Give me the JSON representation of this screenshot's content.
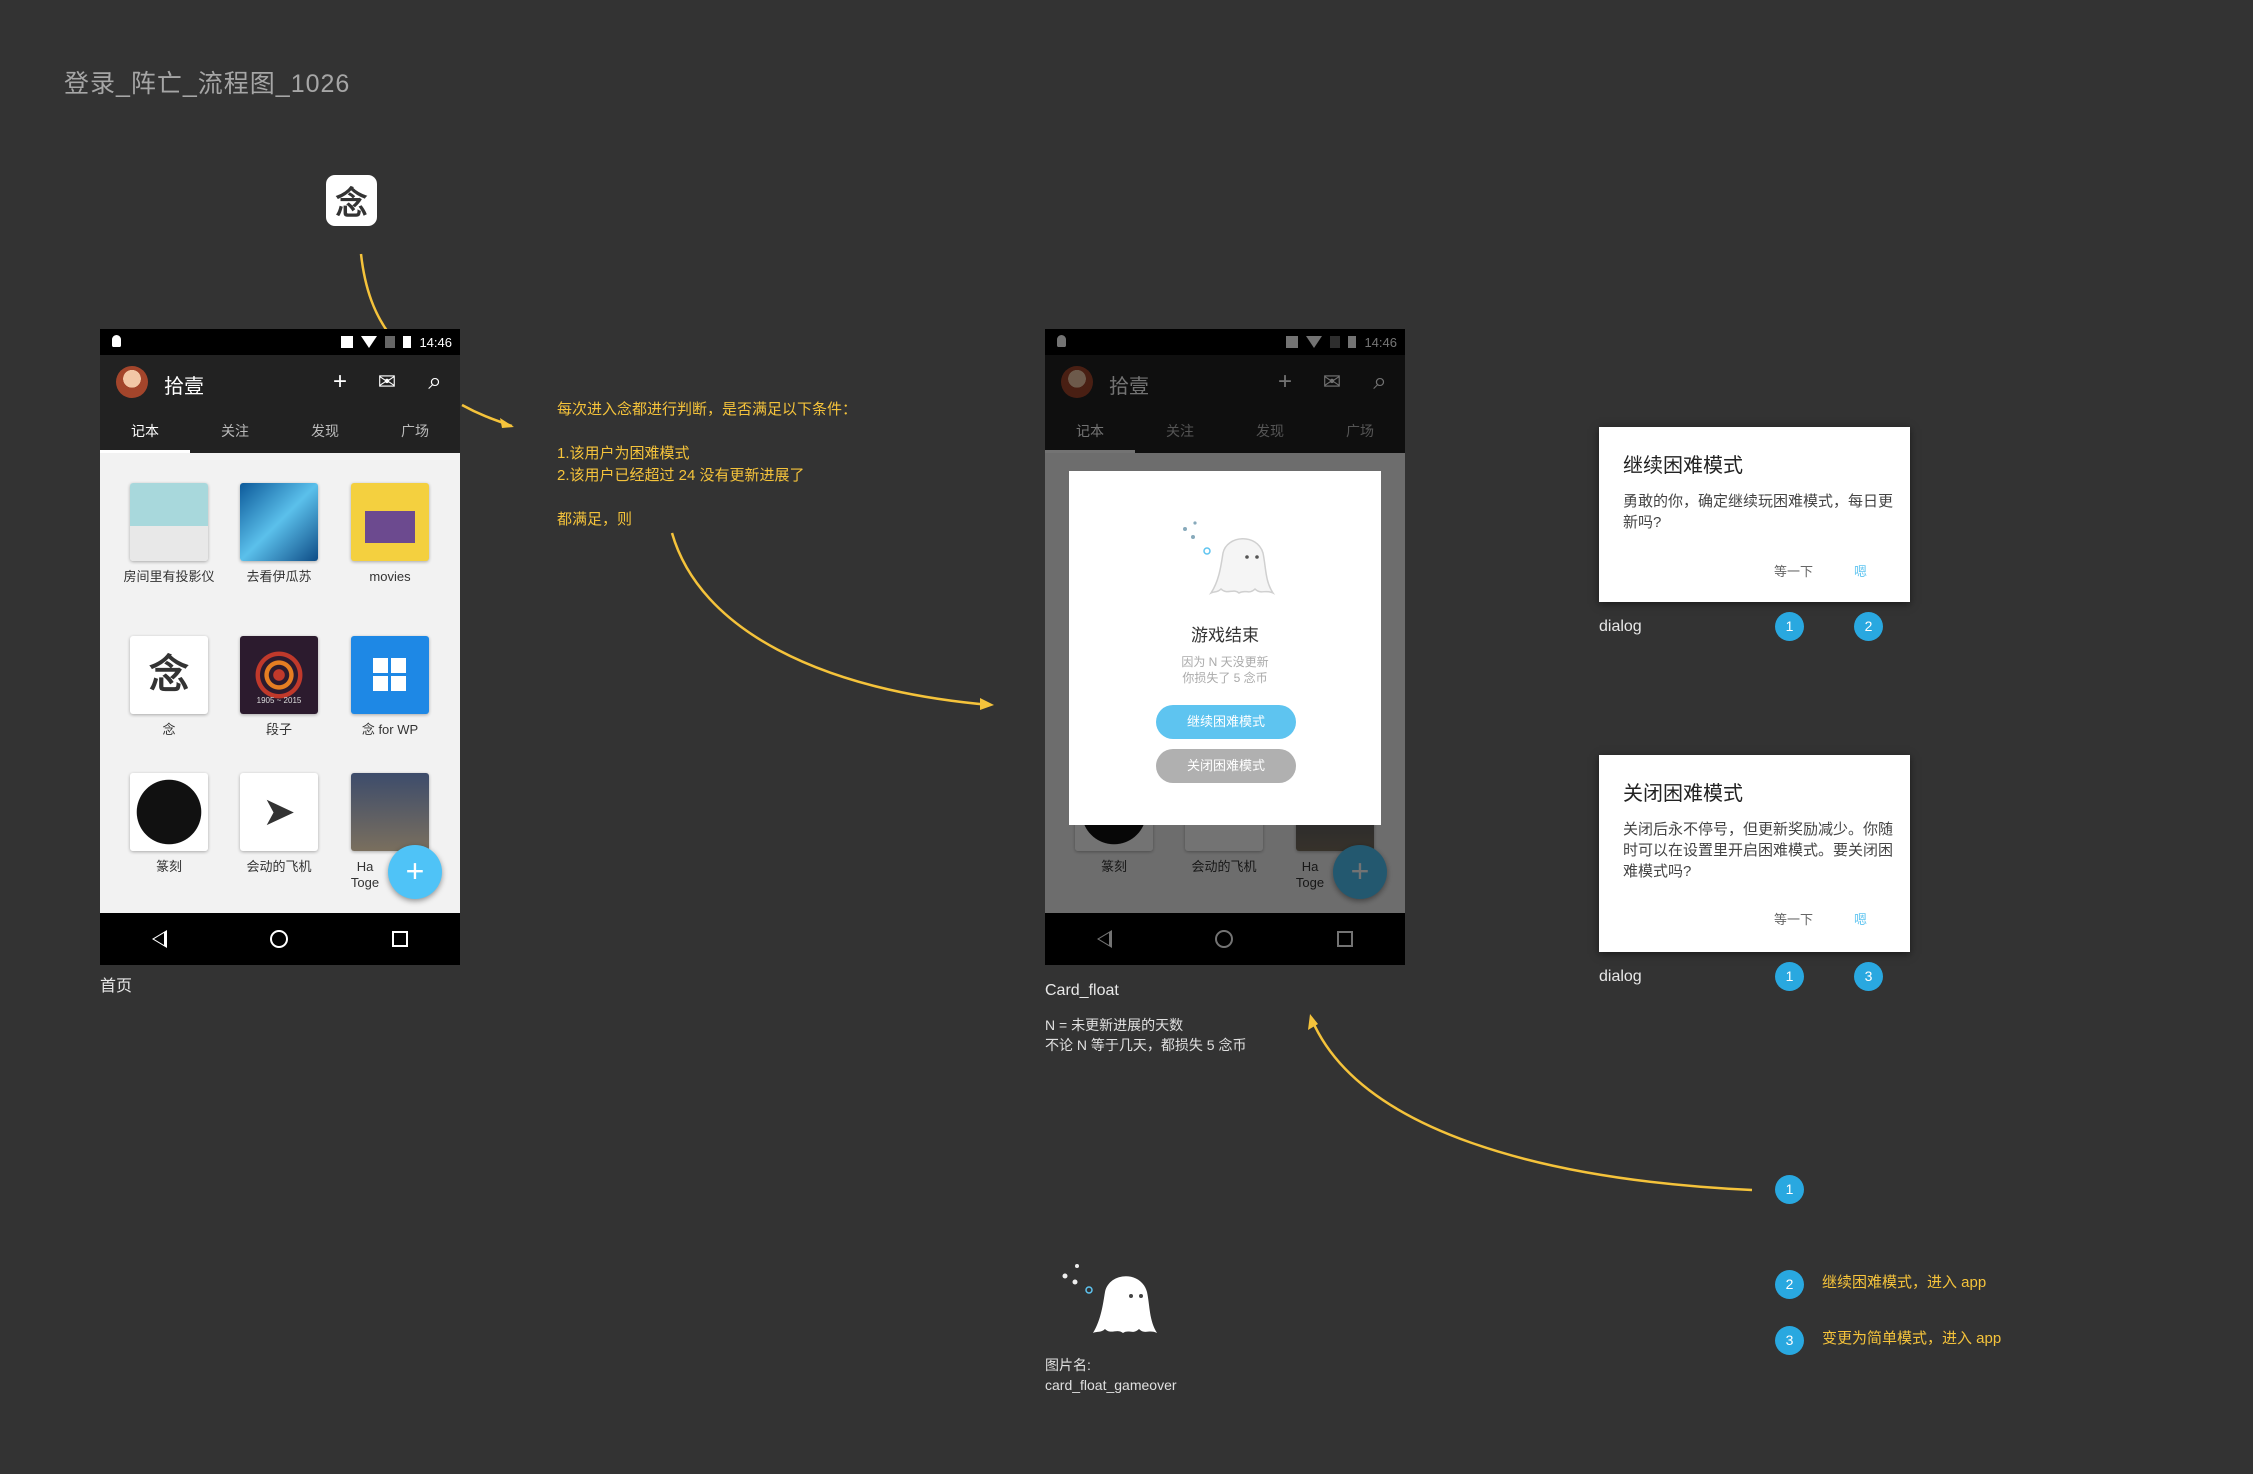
{
  "page_title": "登录_阵亡_流程图_1026",
  "app_icon_char": "念",
  "status_time": "14:46",
  "toolbar": {
    "title": "拾壹",
    "add": "+",
    "mail": "✉",
    "search": "⌕"
  },
  "tabs": [
    "记本",
    "关注",
    "发现",
    "广场"
  ],
  "notebooks": [
    {
      "label": "房间里有投影仪"
    },
    {
      "label": "去看伊瓜苏"
    },
    {
      "label": "movies"
    },
    {
      "label": "念"
    },
    {
      "label": "段子"
    },
    {
      "label": "念 for WP"
    },
    {
      "label": "篆刻"
    },
    {
      "label": "会动的飞机"
    },
    {
      "label": "Ha Toge"
    }
  ],
  "grid_thumb_text": {
    "fingerprint_years": "1905 ~ 2015",
    "nian_char": "念"
  },
  "fab": "+",
  "home_caption": "首页",
  "condition_note": {
    "line1": "每次进入念都进行判断，是否满足以下条件：",
    "line2": "1.该用户为困难模式",
    "line3": "2.该用户已经超过 24 没有更新进展了",
    "line4": "都满足，则"
  },
  "card": {
    "title": "游戏结束",
    "sub1": "因为 N 天没更新",
    "sub2": "你损失了 5 念币",
    "btn_continue": "继续困难模式",
    "btn_close": "关闭困难模式",
    "colors": {
      "continue": "#5ec4f0",
      "close": "#b0b0b0"
    }
  },
  "card_caption": "Card_float",
  "card_note": {
    "line1": "N = 未更新进展的天数",
    "line2": "不论 N 等于几天，都损失 5 念币"
  },
  "image_name": {
    "line1": "图片名:",
    "line2": "card_float_gameover"
  },
  "dialog1": {
    "title": "继续困难模式",
    "body": "勇敢的你，确定继续玩困难模式，每日更新吗?",
    "btn_wait": "等一下",
    "btn_ok": "嗯",
    "caption": "dialog",
    "badges": [
      "1",
      "2"
    ]
  },
  "dialog2": {
    "title": "关闭困难模式",
    "body": "关闭后永不停号，但更新奖励减少。你随时可以在设置里开启困难模式。要关闭困难模式吗?",
    "btn_wait": "等一下",
    "btn_ok": "嗯",
    "caption": "dialog",
    "badges": [
      "1",
      "3"
    ]
  },
  "legend": [
    {
      "num": "1",
      "text": ""
    },
    {
      "num": "2",
      "text": "继续困难模式，进入 app"
    },
    {
      "num": "3",
      "text": "变更为简单模式，进入 app"
    }
  ],
  "colors": {
    "background": "#333333",
    "accent_yellow": "#f5c33b",
    "badge_blue": "#29a8e0"
  }
}
